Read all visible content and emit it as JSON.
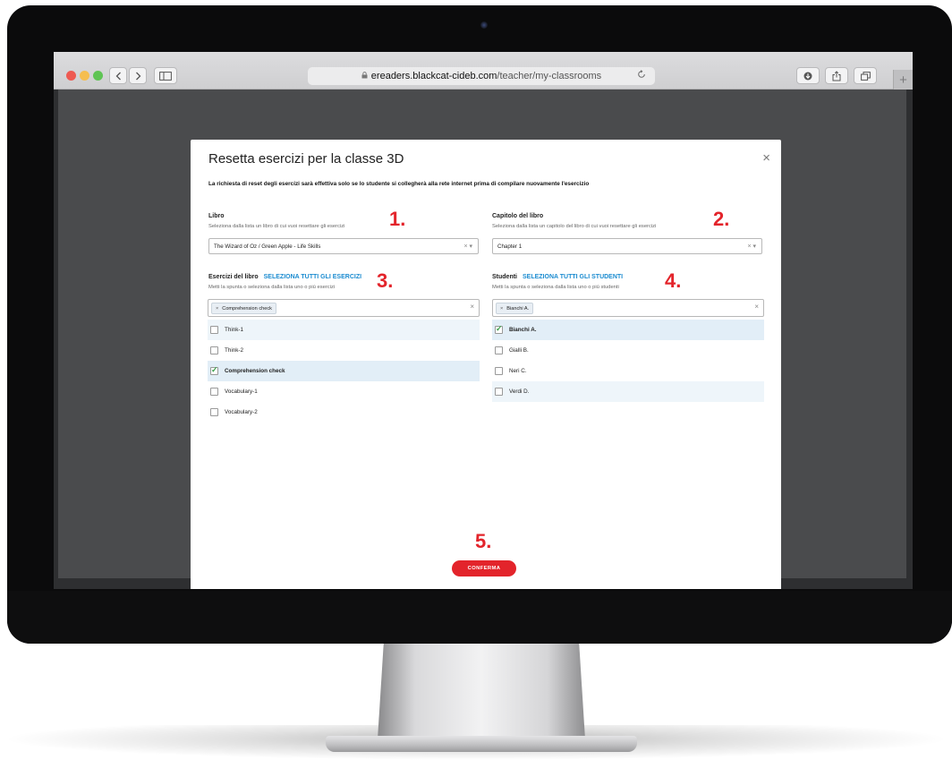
{
  "browser": {
    "url_host": "ereaders.blackcat-cideb.com",
    "url_path": "/teacher/my-classrooms",
    "tab_plus": "+"
  },
  "modal": {
    "title": "Resetta esercizi per la classe 3D",
    "close": "×",
    "notice": "La richiesta di reset degli esercizi sarà effettiva solo se lo studente si collegherà alla rete internet prima di compilare nuovamente l'esercizio",
    "book": {
      "label": "Libro",
      "hint": "Seleziona dalla lista un libro di cui vuoi resettare gli esercizi",
      "value": "The Wizard of Oz / Green Apple - Life Skills",
      "controls": "× ▾"
    },
    "chapter": {
      "label": "Capitolo del libro",
      "hint": "Seleziona dalla lista un capitolo del libro di cui vuoi resettare gli esercizi",
      "value": "Chapter 1",
      "controls": "× ▾"
    },
    "exercises": {
      "label": "Esercizi del libro",
      "select_all": "SELEZIONA TUTTI GLI ESERCIZI",
      "hint": "Metti la spunta o seleziona dalla lista uno o più esercizi",
      "chip_x": "×",
      "chip": "Comprehension check",
      "clear": "×",
      "items": [
        {
          "label": "Think-1",
          "checked": false
        },
        {
          "label": "Think-2",
          "checked": false
        },
        {
          "label": "Comprehension check",
          "checked": true
        },
        {
          "label": "Vocabulary-1",
          "checked": false
        },
        {
          "label": "Vocabulary-2",
          "checked": false
        }
      ]
    },
    "students": {
      "label": "Studenti",
      "select_all": "SELEZIONA TUTTI GLI STUDENTI",
      "hint": "Metti la spunta o seleziona dalla lista uno o più studenti",
      "chip_x": "×",
      "chip": "Bianchi A.",
      "clear": "×",
      "items": [
        {
          "label": "Bianchi A.",
          "checked": true
        },
        {
          "label": "Gialli B.",
          "checked": false
        },
        {
          "label": "Neri C.",
          "checked": false
        },
        {
          "label": "Verdi D.",
          "checked": false
        }
      ]
    },
    "steps": [
      "1.",
      "2.",
      "3.",
      "4.",
      "5."
    ],
    "confirm": "CONFERMA"
  },
  "colors": {
    "accent_red": "#e3242b",
    "link_blue": "#1a8bd0",
    "check_green": "#3aa04a"
  }
}
